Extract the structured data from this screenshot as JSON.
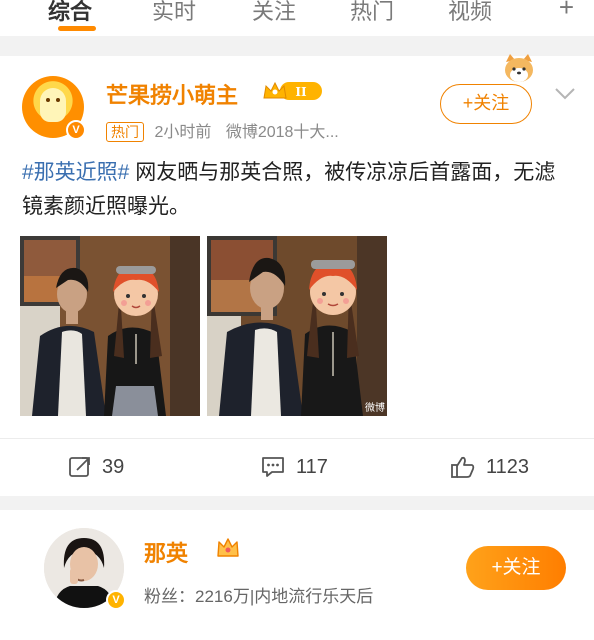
{
  "tabs": [
    {
      "label": "综合",
      "active": true
    },
    {
      "label": "实时",
      "active": false
    },
    {
      "label": "关注",
      "active": false
    },
    {
      "label": "热门",
      "active": false
    },
    {
      "label": "视频",
      "active": false
    }
  ],
  "tab_more": "+",
  "post": {
    "author": "芒果捞小萌主",
    "level_badge": "II",
    "tag": "热门",
    "time": "2小时前",
    "source": "微博2018十大...",
    "follow_label": "+关注",
    "hashtag": "#那英近照#",
    "text": " 网友晒与那英合照，被传凉凉后首露面，无滤镜素颜近照曝光。",
    "watermark": "微博",
    "stats": {
      "reposts": "39",
      "comments": "117",
      "likes": "1123"
    }
  },
  "profile": {
    "name": "那英",
    "fans": "粉丝：2216万|内地流行乐天后",
    "follow_label": "+关注",
    "verified_label": "V"
  },
  "colors": {
    "accent": "#f08200",
    "hashtag": "#3a6fb0",
    "background": "#f2f2f2"
  },
  "icons": [
    "repost-icon",
    "comment-icon",
    "like-icon",
    "chevron-down-icon",
    "crown-icon",
    "verified-icon"
  ]
}
